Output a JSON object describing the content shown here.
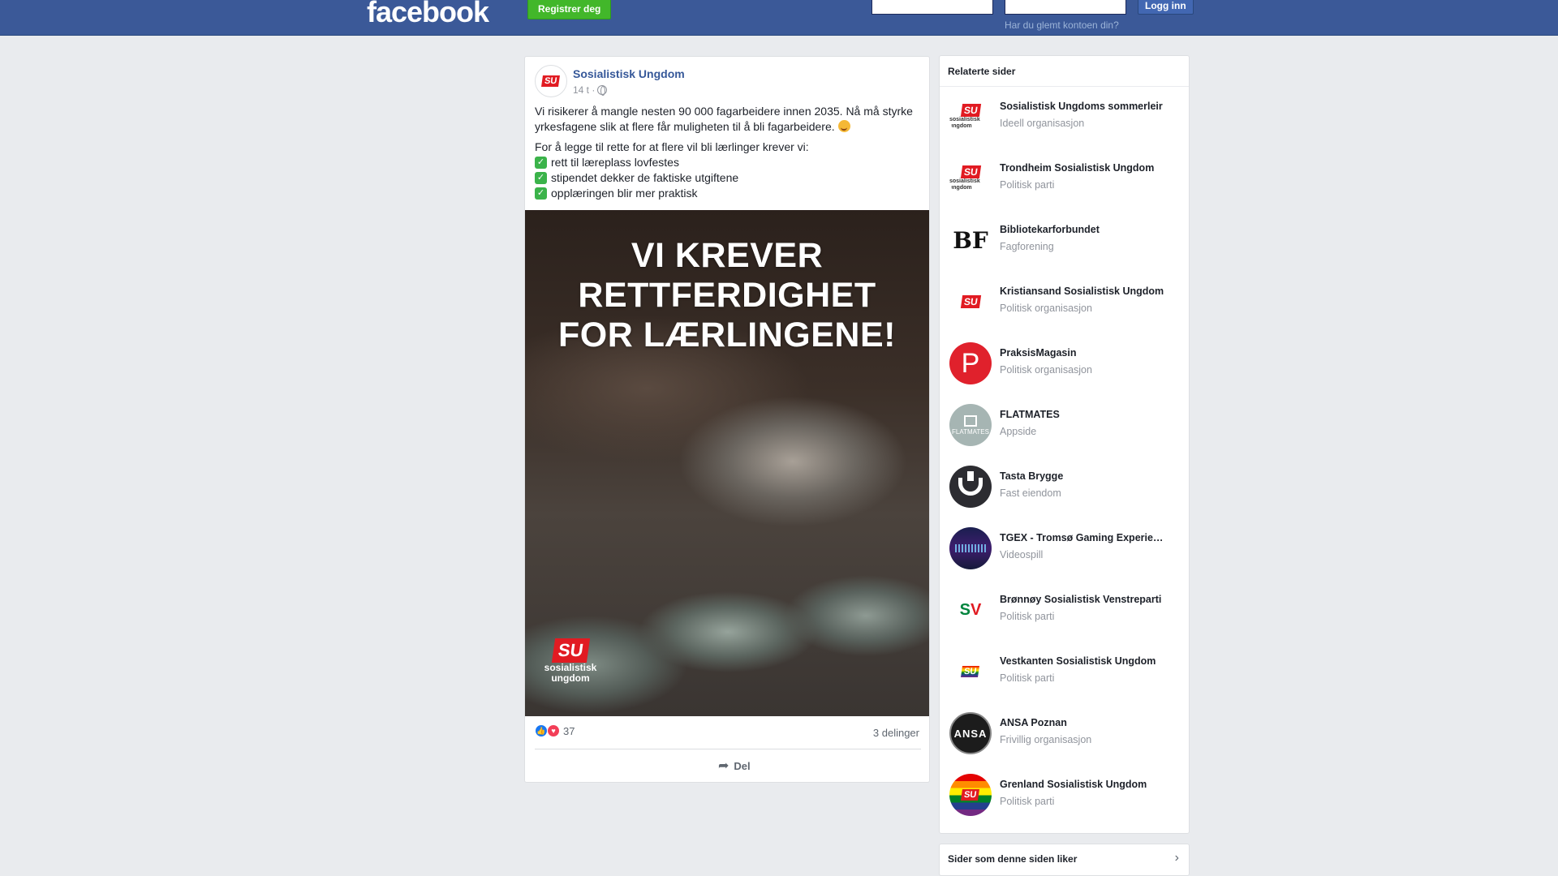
{
  "header": {
    "logo": "facebook",
    "register_label": "Registrer deg",
    "login_label": "Logg inn",
    "forgot_link": "Har du glemt kontoen din?"
  },
  "post": {
    "author": "Sosialistisk Ungdom",
    "time": "14 t ·",
    "paragraph1": "Vi risikerer å mangle nesten 90 000 fagarbeidere innen 2035. Nå må styrke yrkesfagene slik at flere får muligheten til å bli fagarbeidere.",
    "paragraph2": "For å legge til rette for at flere vil bli lærlinger krever vi:",
    "bullets": [
      "rett til læreplass lovfestes",
      "stipendet dekker de faktiske utgiftene",
      "opplæringen blir mer praktisk"
    ],
    "image_headline": [
      "VI KREVER",
      "RETTFERDIGHET",
      "FOR LÆRLINGENE!"
    ],
    "image_logo": {
      "mark": "SU",
      "line1": "sosialistisk",
      "line2": "ungdom"
    },
    "avatar_mark": "SU",
    "reactions_count": "37",
    "shares": "3 delinger",
    "share_label": "Del"
  },
  "related": {
    "title": "Relaterte sider",
    "items": [
      {
        "name": "Sosialistisk Ungdoms sommerleir",
        "category": "Ideell organisasjon"
      },
      {
        "name": "Trondheim Sosialistisk Ungdom",
        "category": "Politisk parti"
      },
      {
        "name": "Bibliotekarforbundet",
        "category": "Fagforening"
      },
      {
        "name": "Kristiansand Sosialistisk Ungdom",
        "category": "Politisk organisasjon"
      },
      {
        "name": "PraksisMagasin",
        "category": "Politisk organisasjon"
      },
      {
        "name": "FLATMATES",
        "category": "Appside"
      },
      {
        "name": "Tasta Brygge",
        "category": "Fast eiendom"
      },
      {
        "name": "TGEX - Tromsø Gaming Experie…",
        "category": "Videospill"
      },
      {
        "name": "Brønnøy Sosialistisk Venstreparti",
        "category": "Politisk parti"
      },
      {
        "name": "Vestkanten Sosialistisk Ungdom",
        "category": "Politisk parti"
      },
      {
        "name": "ANSA Poznan",
        "category": "Frivillig organisasjon"
      },
      {
        "name": "Grenland Sosialistisk Ungdom",
        "category": "Politisk parti"
      }
    ],
    "avatar_marks": {
      "su": "SU",
      "su_small": "sosialistisk ungdom",
      "bf": "BF",
      "p": "P",
      "flatmates": "FLATMATES",
      "sv_s": "S",
      "sv_v": "V",
      "ansa": "ANSA"
    }
  },
  "bottom_card": {
    "title": "Sider som denne siden liker"
  },
  "colors": {
    "brand": "#3b5998",
    "register": "#42b72a",
    "link": "#365899"
  }
}
